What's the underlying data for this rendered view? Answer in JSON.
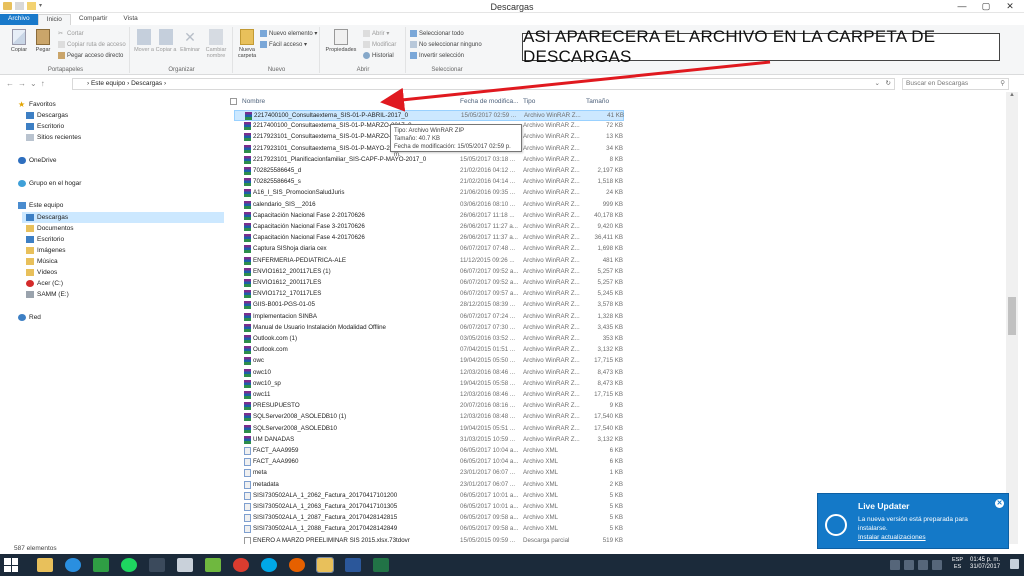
{
  "window": {
    "title": "Descargas",
    "controls": {
      "minimize": "—",
      "maximize": "▢",
      "close": "✕"
    }
  },
  "ribbon": {
    "tabs": [
      "Archivo",
      "Inicio",
      "Compartir",
      "Vista"
    ],
    "groups": {
      "portapapeles": {
        "label": "Portapapeles",
        "copiar": "Copiar",
        "pegar": "Pegar",
        "cortar": "Cortar",
        "copiar_ruta": "Copiar ruta de acceso",
        "pegar_acceso": "Pegar acceso directo"
      },
      "organizar": {
        "label": "Organizar",
        "mover_a": "Mover a",
        "copiar_a": "Copiar a",
        "eliminar": "Eliminar",
        "cambiar_nombre": "Cambiar nombre"
      },
      "nuevo": {
        "label": "Nuevo",
        "nueva_carpeta": "Nueva carpeta",
        "nuevo_elemento": "Nuevo elemento ▾",
        "facil_acceso": "Fácil acceso ▾"
      },
      "abrir": {
        "label": "Abrir",
        "propiedades": "Propiedades",
        "abrir": "Abrir ▾",
        "modificar": "Modificar",
        "historial": "Historial"
      },
      "seleccionar": {
        "label": "Seleccionar",
        "todo": "Seleccionar todo",
        "ninguno": "No seleccionar ninguno",
        "invertir": "Invertir selección"
      }
    }
  },
  "annotation": {
    "text": "ASI APARECERA EL ARCHIVO EN LA CARPETA DE DESCARGAS"
  },
  "address": {
    "back": "←",
    "forward": "→",
    "recent": "⌄",
    "up": "↑",
    "path": "›  Este equipo  ›  Descargas  ›",
    "search_placeholder": "Buscar en Descargas"
  },
  "nav": {
    "favoritos": "Favoritos",
    "descargas_fav": "Descargas",
    "escritorio_fav": "Escritorio",
    "sitios": "Sitios recientes",
    "onedrive": "OneDrive",
    "grupo": "Grupo en el hogar",
    "equipo": "Este equipo",
    "descargas": "Descargas",
    "documentos": "Documentos",
    "escritorio": "Escritorio",
    "imagenes": "Imágenes",
    "musica": "Música",
    "videos": "Vídeos",
    "acer": "Acer (C:)",
    "samm": "SAMM (E:)",
    "red": "Red"
  },
  "columns": {
    "nombre": "Nombre",
    "fecha": "Fecha de modifica...",
    "tipo": "Tipo",
    "tamano": "Tamaño"
  },
  "files": [
    {
      "name": "2217400100_Consultaexterna_SIS-01-P-ABRIL-2017_0",
      "date": "15/05/2017 02:59 ...",
      "type": "Archivo WinRAR Z...",
      "size": "41 KB",
      "icon": "rar"
    },
    {
      "name": "2217400100_Consultaexterna_SIS-01-P-MARZO-2017_0",
      "date": "",
      "type": "Archivo WinRAR Z...",
      "size": "72 KB",
      "icon": "rar"
    },
    {
      "name": "2217923101_Consultaexterna_SIS-01-P-MARZO-20",
      "date": "",
      "type": "Archivo WinRAR Z...",
      "size": "13 KB",
      "icon": "rar"
    },
    {
      "name": "2217923101_Consultaexterna_SIS-01-P-MAYO-201",
      "date": "",
      "type": "Archivo WinRAR Z...",
      "size": "34 KB",
      "icon": "rar"
    },
    {
      "name": "2217923101_Planificacionfamiliar_SIS-CAPF-P-MAYO-2017_0",
      "date": "15/05/2017 03:18 ...",
      "type": "Archivo WinRAR Z...",
      "size": "8 KB",
      "icon": "rar"
    },
    {
      "name": "702825586645_d",
      "date": "21/02/2016 04:12 ...",
      "type": "Archivo WinRAR Z...",
      "size": "2,197 KB",
      "icon": "rar"
    },
    {
      "name": "702825586645_s",
      "date": "21/02/2016 04:14 ...",
      "type": "Archivo WinRAR Z...",
      "size": "1,518 KB",
      "icon": "rar"
    },
    {
      "name": "A16_I_SIS_PromocionSaludJuris",
      "date": "21/06/2016 09:35 ...",
      "type": "Archivo WinRAR Z...",
      "size": "24 KB",
      "icon": "rar"
    },
    {
      "name": "calendario_SIS__2016",
      "date": "03/06/2016 08:10 ...",
      "type": "Archivo WinRAR Z...",
      "size": "999 KB",
      "icon": "rar"
    },
    {
      "name": "Capacitación Nacional Fase 2-20170626",
      "date": "26/06/2017 11:18 ...",
      "type": "Archivo WinRAR Z...",
      "size": "40,178 KB",
      "icon": "rar"
    },
    {
      "name": "Capacitación Nacional Fase 3-20170626",
      "date": "26/06/2017 11:27 a...",
      "type": "Archivo WinRAR Z...",
      "size": "9,420 KB",
      "icon": "rar"
    },
    {
      "name": "Capacitación Nacional Fase 4-20170626",
      "date": "26/06/2017 11:37 a...",
      "type": "Archivo WinRAR Z...",
      "size": "36,411 KB",
      "icon": "rar"
    },
    {
      "name": "Captura SIShoja diaria cex",
      "date": "06/07/2017 07:48 ...",
      "type": "Archivo WinRAR Z...",
      "size": "1,698 KB",
      "icon": "rar"
    },
    {
      "name": "ENFERMERIA-PEDIATRICA-ALE",
      "date": "11/12/2015 09:26 ...",
      "type": "Archivo WinRAR Z...",
      "size": "481 KB",
      "icon": "rar"
    },
    {
      "name": "ENVIO1612_200117LES (1)",
      "date": "06/07/2017 09:52 a...",
      "type": "Archivo WinRAR Z...",
      "size": "5,257 KB",
      "icon": "rar"
    },
    {
      "name": "ENVIO1612_200117LES",
      "date": "06/07/2017 09:52 a...",
      "type": "Archivo WinRAR Z...",
      "size": "5,257 KB",
      "icon": "rar"
    },
    {
      "name": "ENVIO1712_170117LES",
      "date": "06/07/2017 09:57 a...",
      "type": "Archivo WinRAR Z...",
      "size": "5,245 KB",
      "icon": "rar"
    },
    {
      "name": "GIIS-B001-PGS-01-05",
      "date": "28/12/2015 08:39 ...",
      "type": "Archivo WinRAR Z...",
      "size": "3,578 KB",
      "icon": "rar"
    },
    {
      "name": "Implementacion SINBA",
      "date": "06/07/2017 07:24 ...",
      "type": "Archivo WinRAR Z...",
      "size": "1,328 KB",
      "icon": "rar"
    },
    {
      "name": "Manual de Usuario Instalación Modalidad Offline",
      "date": "06/07/2017 07:30 ...",
      "type": "Archivo WinRAR Z...",
      "size": "3,435 KB",
      "icon": "rar"
    },
    {
      "name": "Outlook.com (1)",
      "date": "03/05/2016 03:52 ...",
      "type": "Archivo WinRAR Z...",
      "size": "353 KB",
      "icon": "rar"
    },
    {
      "name": "Outlook.com",
      "date": "07/04/2015 01:51 ...",
      "type": "Archivo WinRAR Z...",
      "size": "3,132 KB",
      "icon": "rar"
    },
    {
      "name": "owc",
      "date": "19/04/2015 05:50 ...",
      "type": "Archivo WinRAR Z...",
      "size": "17,715 KB",
      "icon": "rar"
    },
    {
      "name": "owc10",
      "date": "12/03/2016 08:46 ...",
      "type": "Archivo WinRAR Z...",
      "size": "8,473 KB",
      "icon": "rar"
    },
    {
      "name": "owc10_sp",
      "date": "19/04/2015 05:58 ...",
      "type": "Archivo WinRAR Z...",
      "size": "8,473 KB",
      "icon": "rar"
    },
    {
      "name": "owc11",
      "date": "12/03/2016 08:46 ...",
      "type": "Archivo WinRAR Z...",
      "size": "17,715 KB",
      "icon": "rar"
    },
    {
      "name": "PRESUPUESTO",
      "date": "20/07/2016 08:16 ...",
      "type": "Archivo WinRAR Z...",
      "size": "9 KB",
      "icon": "rar"
    },
    {
      "name": "SQLServer2008_ASOLEDB10 (1)",
      "date": "12/03/2016 08:48 ...",
      "type": "Archivo WinRAR Z...",
      "size": "17,540 KB",
      "icon": "rar"
    },
    {
      "name": "SQLServer2008_ASOLEDB10",
      "date": "19/04/2015 05:51 ...",
      "type": "Archivo WinRAR Z...",
      "size": "17,540 KB",
      "icon": "rar"
    },
    {
      "name": "UM DAÑADAS",
      "date": "31/03/2015 10:59 ...",
      "type": "Archivo WinRAR Z...",
      "size": "3,132 KB",
      "icon": "rar"
    },
    {
      "name": "FACT_AAA9959",
      "date": "06/05/2017 10:04 a...",
      "type": "Archivo XML",
      "size": "6 KB",
      "icon": "xml"
    },
    {
      "name": "FACT_AAA9960",
      "date": "06/05/2017 10:04 a...",
      "type": "Archivo XML",
      "size": "6 KB",
      "icon": "xml"
    },
    {
      "name": "meta",
      "date": "23/01/2017 06:07 ...",
      "type": "Archivo XML",
      "size": "1 KB",
      "icon": "xml"
    },
    {
      "name": "metadata",
      "date": "23/01/2017 06:07 ...",
      "type": "Archivo XML",
      "size": "2 KB",
      "icon": "xml"
    },
    {
      "name": "SISI730502ALA_1_2062_Factura_20170417101200",
      "date": "06/05/2017 10:01 a...",
      "type": "Archivo XML",
      "size": "5 KB",
      "icon": "xml"
    },
    {
      "name": "SISI730502ALA_1_2063_Factura_20170417101305",
      "date": "06/05/2017 10:01 a...",
      "type": "Archivo XML",
      "size": "5 KB",
      "icon": "xml"
    },
    {
      "name": "SISI730502ALA_1_2087_Factura_20170428142815",
      "date": "06/05/2017 09:58 a...",
      "type": "Archivo XML",
      "size": "5 KB",
      "icon": "xml"
    },
    {
      "name": "SISI730502ALA_1_2088_Factura_20170428142849",
      "date": "06/05/2017 09:58 a...",
      "type": "Archivo XML",
      "size": "5 KB",
      "icon": "xml"
    },
    {
      "name": "ENERO A MARZO PREELIMINAR SIS 2015.xlsx.73tdovr",
      "date": "15/05/2015 09:59 ...",
      "type": "Descarga parcial",
      "size": "519 KB",
      "icon": "part"
    }
  ],
  "tooltip": {
    "line1": "Tipo: Archivo WinRAR ZIP",
    "line2": "Tamaño: 40.7 KB",
    "line3": "Fecha de modificación: 15/05/2017 02:59 p. m."
  },
  "status": {
    "count": "587 elementos"
  },
  "notification": {
    "title": "Live Updater",
    "body": "La nueva versión está preparada para instalarse.",
    "link": "Instalar actualizaciones",
    "close": "✕"
  },
  "taskbar": {
    "lang1": "ESP",
    "lang2": "ES",
    "time": "01:45 p. m.",
    "date": "31/07/2017"
  },
  "colors": {
    "accent": "#1979ca",
    "selection": "#cce8ff",
    "annotation_arrow": "#e0191f",
    "notification": "#1479c8",
    "taskbar": "#1b2a3a"
  }
}
